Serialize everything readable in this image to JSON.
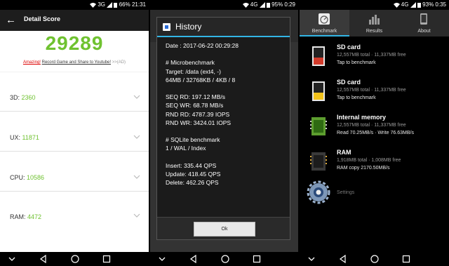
{
  "panel1": {
    "status": {
      "network": "3G",
      "battery": "66%",
      "time": "21:31"
    },
    "header_title": "Detail Score",
    "total_score": "29289",
    "ad": {
      "highlight": "Amazing!",
      "link": "Record Game and Share to Youtube!",
      "suffix": ">>(AD)"
    },
    "scores": [
      {
        "label": "3D:",
        "value": "2360"
      },
      {
        "label": "UX:",
        "value": "11871"
      },
      {
        "label": "CPU:",
        "value": "10586"
      },
      {
        "label": "RAM:",
        "value": "4472"
      }
    ],
    "colors": {
      "score_green": "#6fc230",
      "header_bg": "#1d1d1d"
    }
  },
  "panel2": {
    "status": {
      "network": "4G",
      "battery": "95%",
      "time": "0:29"
    },
    "dialog_title": "History",
    "history_text": "Date : 2017-06-22 00:29:28\n\n# Microbenchmark\nTarget: /data (ext4, -)\n64MB / 32768KB / 4KB / 8\n\nSEQ RD: 197.12 MB/s\nSEQ WR: 68.78 MB/s\nRND RD: 4787.39 IOPS\nRND WR: 3424.01 IOPS\n\n# SQLite benchmark\n1 / WAL / Index\n\nInsert: 335.44 QPS\nUpdate: 418.45 QPS\nDelete: 462.26 QPS",
    "ok_label": "Ok",
    "colors": {
      "accent": "#33b5e5"
    }
  },
  "panel3": {
    "status": {
      "network": "4G",
      "battery": "93%",
      "time": "0:35"
    },
    "tabs": [
      {
        "label": "Benchmark",
        "icon": "speedometer-icon"
      },
      {
        "label": "Results",
        "icon": "bar-chart-icon"
      },
      {
        "label": "About",
        "icon": "phone-icon"
      }
    ],
    "items": [
      {
        "name": "SD card",
        "info": "12,557MB total · 11,337MB free",
        "sub": "Tap to benchmark",
        "icon": "sd-card-red-icon"
      },
      {
        "name": "SD card",
        "info": "12,557MB total · 11,337MB free",
        "sub": "Tap to benchmark",
        "icon": "sd-card-yellow-icon"
      },
      {
        "name": "Internal memory",
        "info": "12,557MB total · 11,337MB free",
        "sub": "Read 70.25MB/s · Write 76.63MB/s",
        "icon": "internal-memory-icon"
      },
      {
        "name": "RAM",
        "info": "1,918MB total · 1,008MB free",
        "sub": "RAM copy 2170.50MB/s",
        "icon": "ram-chip-icon"
      }
    ],
    "settings_label": "Settings",
    "colors": {
      "accent": "#33b5e5"
    }
  }
}
